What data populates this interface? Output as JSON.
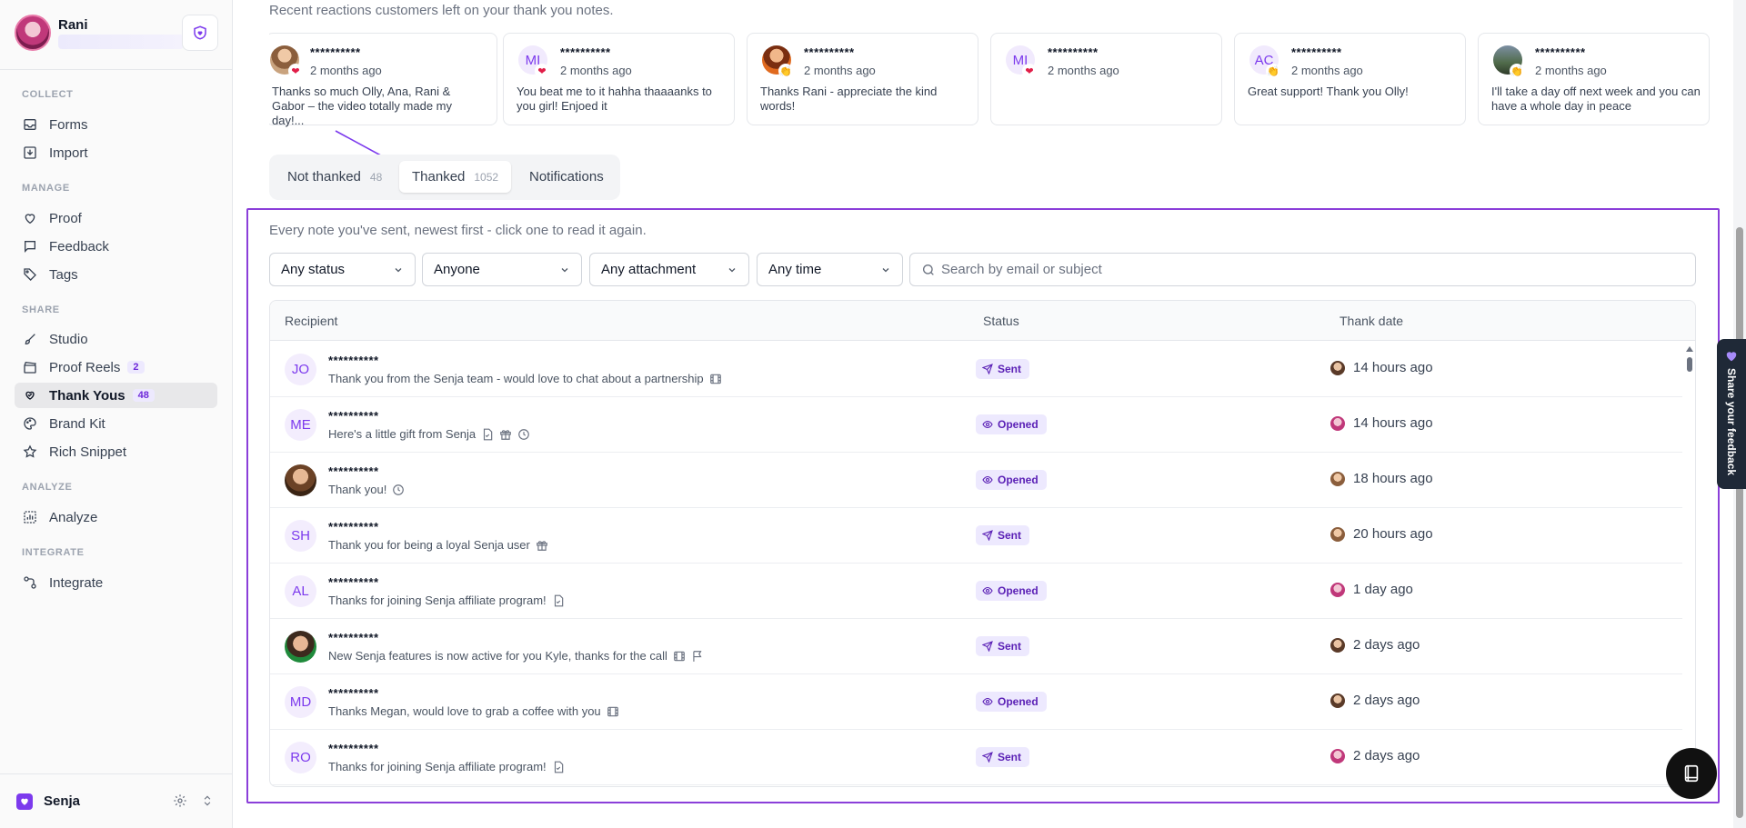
{
  "sidebar": {
    "user_name": "Rani",
    "sections": {
      "collect": "COLLECT",
      "manage": "MANAGE",
      "share": "SHARE",
      "analyze": "ANALYZE",
      "integrate": "INTEGRATE"
    },
    "items": {
      "forms": "Forms",
      "import": "Import",
      "proof": "Proof",
      "feedback": "Feedback",
      "tags": "Tags",
      "studio": "Studio",
      "proof_reels": "Proof Reels",
      "proof_reels_count": "2",
      "thank_yous": "Thank Yous",
      "thank_yous_count": "48",
      "brand_kit": "Brand Kit",
      "rich_snippet": "Rich Snippet",
      "analyze": "Analyze",
      "integrate": "Integrate"
    },
    "brand": "Senja"
  },
  "intro": "Recent reactions customers left on your thank you notes.",
  "reactions": [
    {
      "name": "**********",
      "time": "2 months ago",
      "text": "Thanks so much Olly, Ana, Rani & Gabor – the video totally made my day!...",
      "reaction": "heart"
    },
    {
      "initials": "MI",
      "name": "**********",
      "time": "2 months ago",
      "text": "You beat me to it hahha thaaaanks to you girl! Enjoed it",
      "reaction": "heart"
    },
    {
      "name": "**********",
      "time": "2 months ago",
      "text": "Thanks Rani - appreciate the kind words!",
      "reaction": "clap"
    },
    {
      "initials": "MI",
      "name": "**********",
      "time": "2 months ago",
      "text": "",
      "reaction": "heart"
    },
    {
      "initials": "AC",
      "name": "**********",
      "time": "2 months ago",
      "text": "Great support! Thank you Olly!",
      "reaction": "clap"
    },
    {
      "name": "**********",
      "time": "2 months ago",
      "text": "I'll take a day off next week and you can have a whole day in peace",
      "reaction": "clap"
    }
  ],
  "tabs": {
    "not_thanked": "Not thanked",
    "not_thanked_count": "48",
    "thanked": "Thanked",
    "thanked_count": "1052",
    "notifications": "Notifications"
  },
  "list_description": "Every note you've sent, newest first - click one to read it again.",
  "filters": {
    "status": "Any status",
    "person": "Anyone",
    "attachment": "Any attachment",
    "time": "Any time",
    "search_placeholder": "Search by email or subject"
  },
  "table": {
    "headers": {
      "recipient": "Recipient",
      "status": "Status",
      "date": "Thank date"
    },
    "rows": [
      {
        "initials": "JO",
        "name": "**********",
        "subject": "Thank you from the Senja team - would love to chat about a partnership",
        "attachments": [
          "video-icon"
        ],
        "status": "Sent",
        "date": "14 hours ago"
      },
      {
        "initials": "ME",
        "name": "**********",
        "subject": "Here's a little gift from Senja",
        "attachments": [
          "document-icon",
          "gift-icon",
          "clock-icon"
        ],
        "status": "Opened",
        "date": "14 hours ago"
      },
      {
        "name": "**********",
        "subject": "Thank you!",
        "attachments": [
          "clock-icon"
        ],
        "status": "Opened",
        "date": "18 hours ago"
      },
      {
        "initials": "SH",
        "name": "**********",
        "subject": "Thank you for being a loyal Senja user",
        "attachments": [
          "gift-icon"
        ],
        "status": "Sent",
        "date": "20 hours ago"
      },
      {
        "initials": "AL",
        "name": "**********",
        "subject": "Thanks for joining Senja affiliate program!",
        "attachments": [
          "document-icon"
        ],
        "status": "Opened",
        "date": "1 day ago"
      },
      {
        "name": "**********",
        "subject": "New Senja features is now active for you Kyle, thanks for the call",
        "attachments": [
          "video-icon",
          "flag-icon"
        ],
        "status": "Sent",
        "date": "2 days ago"
      },
      {
        "initials": "MD",
        "name": "**********",
        "subject": "Thanks Megan, would love to grab a coffee with you",
        "attachments": [
          "video-icon"
        ],
        "status": "Opened",
        "date": "2 days ago"
      },
      {
        "initials": "RO",
        "name": "**********",
        "subject": "Thanks for joining Senja affiliate program!",
        "attachments": [
          "document-icon"
        ],
        "status": "Sent",
        "date": "2 days ago"
      }
    ]
  },
  "feedback_tab": "Share your feedback",
  "colors": {
    "accent": "#7c3aed",
    "highlight_frame": "#8b3fd9",
    "badge_bg": "#ede9fe"
  }
}
